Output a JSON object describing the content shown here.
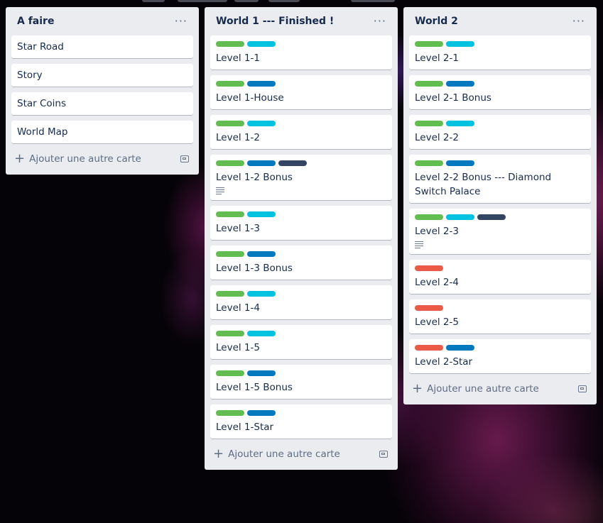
{
  "colors": {
    "green": "#61bd4f",
    "sky": "#00c2e0",
    "blue": "#0079bf",
    "navy": "#344563",
    "red": "#eb5a46"
  },
  "lists": [
    {
      "title": "A faire",
      "menu": "···",
      "add_label": "Ajouter une autre carte",
      "cards": [
        {
          "title": "Star Road"
        },
        {
          "title": "Story"
        },
        {
          "title": "Star Coins"
        },
        {
          "title": "World Map"
        }
      ]
    },
    {
      "title": "World 1 --- Finished !",
      "menu": "···",
      "add_label": "Ajouter une autre carte",
      "cards": [
        {
          "title": "Level 1-1",
          "labels": [
            "green",
            "sky"
          ]
        },
        {
          "title": "Level 1-House",
          "labels": [
            "green",
            "blue"
          ]
        },
        {
          "title": "Level 1-2",
          "labels": [
            "green",
            "sky"
          ]
        },
        {
          "title": "Level 1-2 Bonus",
          "labels": [
            "green",
            "blue",
            "navy"
          ],
          "description_icon": "description-icon"
        },
        {
          "title": "Level 1-3",
          "labels": [
            "green",
            "sky"
          ]
        },
        {
          "title": "Level 1-3 Bonus",
          "labels": [
            "green",
            "blue"
          ]
        },
        {
          "title": "Level 1-4",
          "labels": [
            "green",
            "sky"
          ]
        },
        {
          "title": "Level 1-5",
          "labels": [
            "green",
            "sky"
          ]
        },
        {
          "title": "Level 1-5 Bonus",
          "labels": [
            "green",
            "blue"
          ]
        },
        {
          "title": "Level 1-Star",
          "labels": [
            "green",
            "blue"
          ]
        }
      ]
    },
    {
      "title": "World 2",
      "menu": "···",
      "add_label": "Ajouter une autre carte",
      "cards": [
        {
          "title": "Level 2-1",
          "labels": [
            "green",
            "sky"
          ]
        },
        {
          "title": "Level 2-1 Bonus",
          "labels": [
            "green",
            "blue"
          ]
        },
        {
          "title": "Level 2-2",
          "labels": [
            "green",
            "sky"
          ]
        },
        {
          "title": "Level 2-2 Bonus --- Diamond Switch Palace",
          "labels": [
            "green",
            "blue"
          ]
        },
        {
          "title": "Level 2-3",
          "labels": [
            "green",
            "sky",
            "navy"
          ],
          "description_icon": "description-icon"
        },
        {
          "title": "Level 2-4",
          "labels": [
            "red"
          ]
        },
        {
          "title": "Level 2-5",
          "labels": [
            "red"
          ]
        },
        {
          "title": "Level 2-Star",
          "labels": [
            "red",
            "blue"
          ]
        }
      ]
    }
  ]
}
